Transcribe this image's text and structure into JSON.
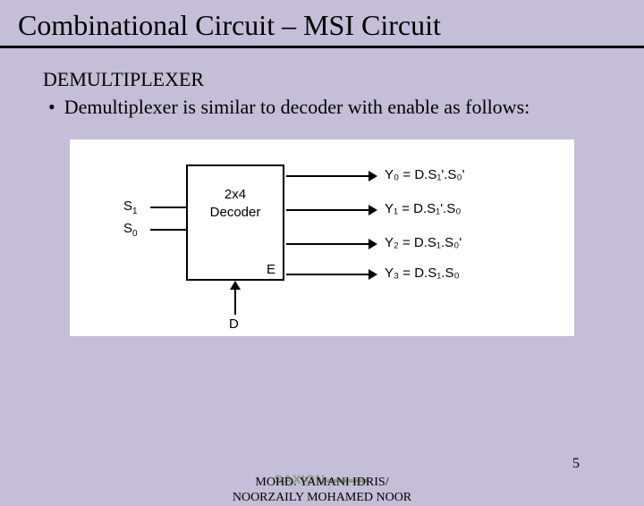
{
  "title": "Combinational Circuit – MSI Circuit",
  "section_heading": "DEMULTIPLEXER",
  "bullet_text": "Demultiplexer is similar to decoder with enable as follows:",
  "diagram": {
    "box_line1": "2x4",
    "box_line2": "Decoder",
    "enable_label": "E",
    "inputs": {
      "s1": "S",
      "s1_sub": "1",
      "s0": "S",
      "s0_sub": "0"
    },
    "data_in": "D",
    "outputs": {
      "y0": "Y₀ = D.S₁'.S₀'",
      "y1": "Y₁ = D.S₁'.S₀",
      "y2": "Y₂ = D.S₁.S₀'",
      "y3": "Y₃ = D.S₁.S₀"
    }
  },
  "footer": {
    "logo_text": "SAXION",
    "author_line1": "MOHD. YAMANI IDRIS/",
    "author_line2": "NOORZAILY MOHAMED NOOR",
    "page": "5"
  }
}
